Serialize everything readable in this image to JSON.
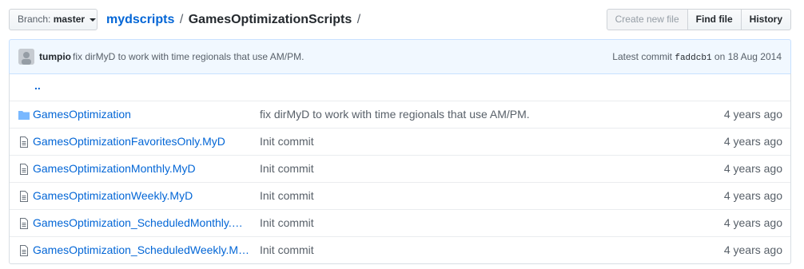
{
  "branch": {
    "prefix": "Branch:",
    "name": "master"
  },
  "breadcrumb": {
    "repo": "mydscripts",
    "separator": "/",
    "directory": "GamesOptimizationScripts",
    "trailing": "/"
  },
  "actions": {
    "create_new_file": "Create new file",
    "find_file": "Find file",
    "history": "History"
  },
  "latest_commit": {
    "author": "tumpio",
    "message": "fix dirMyD to work with time regionals that use AM/PM.",
    "label": "Latest commit",
    "sha": "faddcb1",
    "date": "on 18 Aug 2014"
  },
  "files": {
    "up_label": "..",
    "items": [
      {
        "type": "directory",
        "name": "GamesOptimization",
        "message": "fix dirMyD to work with time regionals that use AM/PM.",
        "age": "4 years ago"
      },
      {
        "type": "file",
        "name": "GamesOptimizationFavoritesOnly.MyD",
        "message": "Init commit",
        "age": "4 years ago"
      },
      {
        "type": "file",
        "name": "GamesOptimizationMonthly.MyD",
        "message": "Init commit",
        "age": "4 years ago"
      },
      {
        "type": "file",
        "name": "GamesOptimizationWeekly.MyD",
        "message": "Init commit",
        "age": "4 years ago"
      },
      {
        "type": "file",
        "name": "GamesOptimization_ScheduledMonthly.MyD",
        "message": "Init commit",
        "age": "4 years ago"
      },
      {
        "type": "file",
        "name": "GamesOptimization_ScheduledWeekly.MyD",
        "message": "Init commit",
        "age": "4 years ago"
      }
    ]
  },
  "colors": {
    "link": "#0366d6",
    "folder": "#79b8ff",
    "file_icon": "#6a737d",
    "commit_bg": "#f1f8ff"
  }
}
